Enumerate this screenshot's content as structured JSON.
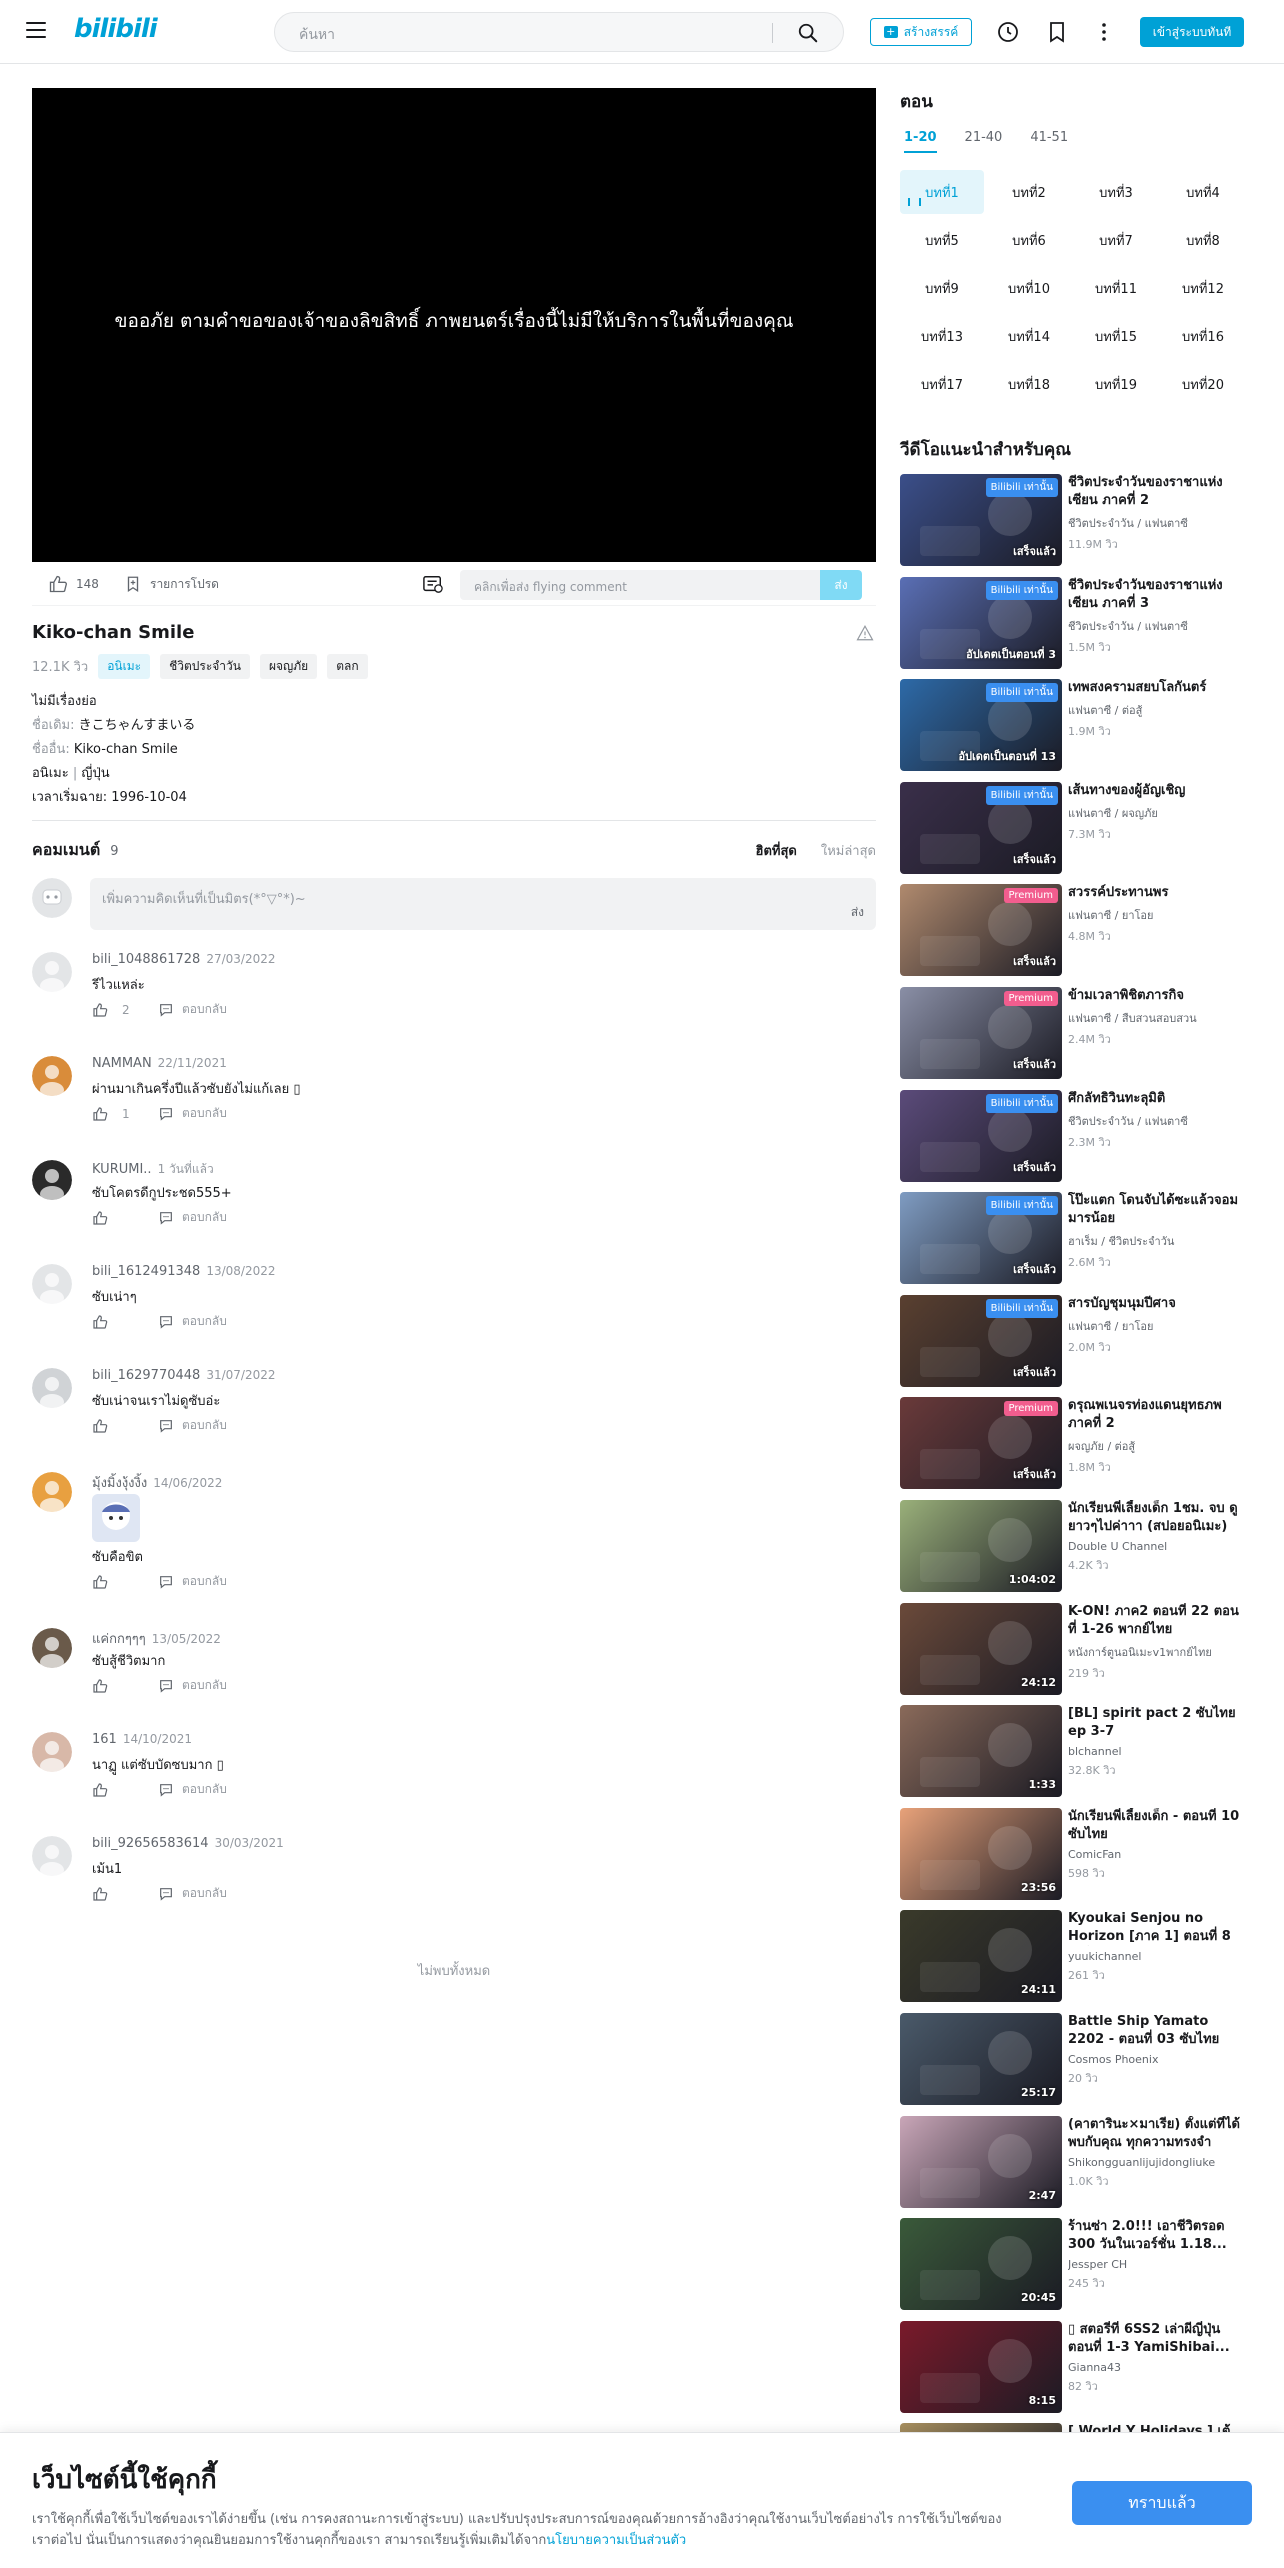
{
  "header": {
    "logo": "bilibili",
    "search_placeholder": "ค้นหา",
    "create_label": "สร้างสรรค์",
    "login_label": "เข้าสู่ระบบทันที"
  },
  "player": {
    "message": "ขออภัย ตามคำขอของเจ้าของลิขสิทธิ์ ภาพยนตร์เรื่องนี้ไม่มีให้บริการในพื้นที่ของคุณ",
    "likes": "148",
    "favorite_label": "รายการโปรด",
    "danmaku_placeholder": "คลิกเพื่อส่ง flying comment",
    "send_label": "ส่ง"
  },
  "video": {
    "title": "Kiko-chan Smile",
    "views": "12.1K วิว",
    "tags": [
      "อนิเมะ",
      "ชีวิตประจำวัน",
      "ผจญภัย",
      "ตลก"
    ],
    "synopsis": "ไม่มีเรื่องย่อ",
    "original_name_label": "ชื่อเดิม:",
    "original_name": "きこちゃんすまいる",
    "other_name_label": "ชื่ออื่น:",
    "other_name": "Kiko-chan Smile",
    "category": "อนิเมะ",
    "country": "ญี่ปุ่น",
    "airdate": "เวลาเริ่มฉาย: 1996-10-04"
  },
  "comments": {
    "title": "คอมเมนต์",
    "count": "9",
    "sort_hot": "ฮิตที่สุด",
    "sort_new": "ใหม่ล่าสุด",
    "input_placeholder": "เพิ่มความคิดเห็นที่เป็นมิตร(*°▽°*)~",
    "input_send": "ส่ง",
    "reply_label": "ตอบกลับ",
    "no_more": "ไม่พบทั้งหมด",
    "items": [
      {
        "user": "bili_1048861728",
        "date": "27/03/2022",
        "text": "รีไวแหล่ะ",
        "likes": "2"
      },
      {
        "user": "NAMMAN",
        "date": "22/11/2021",
        "text": "ผ่านมาเกินครึ่งปีแล้วซับยังไม่แก้เลย ▯",
        "likes": "1"
      },
      {
        "user": "KURUMI..",
        "date": "1 วันที่แล้ว",
        "text": "ซับโคตรดีกูประชด555+",
        "likes": ""
      },
      {
        "user": "bili_1612491348",
        "date": "13/08/2022",
        "text": "ซับเน่าๆ",
        "likes": ""
      },
      {
        "user": "bili_1629770448",
        "date": "31/07/2022",
        "text": "ซับเน่าจนเราไม่ดูซับอ่ะ",
        "likes": ""
      },
      {
        "user": "มุ้งมิ้งงุ้งงิ้ง",
        "date": "14/06/2022",
        "text": "ซับคือขิต",
        "likes": ""
      },
      {
        "user": "แค่กกๆๆๆ",
        "date": "13/05/2022",
        "text": "ซับสู้ชีวิตมาก",
        "likes": ""
      },
      {
        "user": "161",
        "date": "14/10/2021",
        "text": "นาฏู แต่ซับบัดซบมาก ▯",
        "likes": ""
      },
      {
        "user": "bili_92656583614",
        "date": "30/03/2021",
        "text": "เม้น1",
        "likes": ""
      }
    ]
  },
  "episodes": {
    "title": "ตอน",
    "tabs": [
      "1-20",
      "21-40",
      "41-51"
    ],
    "items": [
      "บทที่1",
      "บทที่2",
      "บทที่3",
      "บทที่4",
      "บทที่5",
      "บทที่6",
      "บทที่7",
      "บทที่8",
      "บทที่9",
      "บทที่10",
      "บทที่11",
      "บทที่12",
      "บทที่13",
      "บทที่14",
      "บทที่15",
      "บทที่16",
      "บทที่17",
      "บทที่18",
      "บทที่19",
      "บทที่20"
    ]
  },
  "recommend": {
    "title": "วีดีโอแนะนำสำหรับคุณ",
    "items": [
      {
        "name": "ชีวิตประจำวันของราชาแห่งเซียน ภาคที่ 2",
        "sub": "ชีวิตประจำวัน / แฟนตาซี",
        "views": "11.9M วิว",
        "badge": "Bilibili เท่านั้น",
        "corner": "เสร็จแล้ว",
        "color": "#3b4f8a"
      },
      {
        "name": "ชีวิตประจำวันของราชาแห่งเซียน ภาคที่ 3",
        "sub": "ชีวิตประจำวัน / แฟนตาซี",
        "views": "1.5M วิว",
        "badge": "Bilibili เท่านั้น",
        "corner": "อัปเดตเป็นตอนที่ 3",
        "color": "#5a6fb5"
      },
      {
        "name": "เทพสงครามสยบโลกันตร์",
        "sub": "แฟนตาซี / ต่อสู้",
        "views": "1.9M วิว",
        "badge": "Bilibili เท่านั้น",
        "corner": "อัปเดตเป็นตอนที่ 13",
        "color": "#2d6aa8"
      },
      {
        "name": "เส้นทางของผู้อัญเชิญ",
        "sub": "แฟนตาซี / ผจญภัย",
        "views": "7.3M วิว",
        "badge": "Bilibili เท่านั้น",
        "corner": "เสร็จแล้ว",
        "color": "#3a2f4a"
      },
      {
        "name": "สวรรค์ประทานพร",
        "sub": "แฟนตาซี / ยาโอย",
        "views": "4.8M วิว",
        "badge": "Premium",
        "corner": "เสร็จแล้ว",
        "color": "#b08a6e"
      },
      {
        "name": "ข้ามเวลาพิชิตภารกิจ",
        "sub": "แฟนตาซี / สืบสวนสอบสวน",
        "views": "2.4M วิว",
        "badge": "Premium",
        "corner": "เสร็จแล้ว",
        "color": "#8a8fa6"
      },
      {
        "name": "ศึกลัทธิวินทะลุมิติ",
        "sub": "ชีวิตประจำวัน / แฟนตาซี",
        "views": "2.3M วิว",
        "badge": "Bilibili เท่านั้น",
        "corner": "เสร็จแล้ว",
        "color": "#5b4b7a"
      },
      {
        "name": "โป๊ะแตก โดนจับได้ซะแล้วจอมมารน้อย",
        "sub": "ฮาเร็ม / ชีวิตประจำวัน",
        "views": "2.6M วิว",
        "badge": "Bilibili เท่านั้น",
        "corner": "เสร็จแล้ว",
        "color": "#7f9cc2"
      },
      {
        "name": "สารบัญชุมนุมปีศาจ",
        "sub": "แฟนตาซี / ยาโอย",
        "views": "2.0M วิว",
        "badge": "Bilibili เท่านั้น",
        "corner": "เสร็จแล้ว",
        "color": "#5a4030"
      },
      {
        "name": "ดรุณพเนจรท่องแดนยุทธภพ ภาคที่ 2",
        "sub": "ผจญภัย / ต่อสู้",
        "views": "1.8M วิว",
        "badge": "Premium",
        "corner": "เสร็จแล้ว",
        "color": "#6a3a3a"
      },
      {
        "name": "นักเรียนพี่เลี้ยงเด็ก 1ชม. จบ ดูยาวๆไปค่าาา (สปอยอนิเมะ)",
        "sub": "Double U Channel",
        "views": "4.2K วิว",
        "badge": "",
        "corner": "1:04:02",
        "color": "#9ab07a"
      },
      {
        "name": "K-ON! ภาค2 ตอนที่ 22 ตอนที่ 1-26 พากย์ไทย",
        "sub": "หนังการ์ตูนอนิเมะv1พากย์ไทย",
        "views": "219 วิว",
        "badge": "",
        "corner": "24:12",
        "color": "#6b4a3a"
      },
      {
        "name": "[BL] spirit pact 2 ซับไทย ep 3-7",
        "sub": "blchannel",
        "views": "32.8K วิว",
        "badge": "",
        "corner": "1:33",
        "color": "#8a6a5a"
      },
      {
        "name": "นักเรียนพี่เลี้ยงเด็ก - ตอนที่ 10 ซับไทย",
        "sub": "ComicFan",
        "views": "598 วิว",
        "badge": "",
        "corner": "23:56",
        "color": "#e8a27a"
      },
      {
        "name": "Kyoukai Senjou no Horizon [ภาค 1] ตอนที่ 8 ซับไทย",
        "sub": "yuukichannel",
        "views": "261 วิว",
        "badge": "",
        "corner": "24:11",
        "color": "#3a3a2a"
      },
      {
        "name": "Battle Ship Yamato 2202 - ตอนที่ 03 ซับไทย",
        "sub": "Cosmos Phoenix",
        "views": "20 วิว",
        "badge": "",
        "corner": "25:17",
        "color": "#4a5a6a"
      },
      {
        "name": "(คาตารินะ×มาเรีย) ตั้งแต่ที่ได้พบกับคุณ ทุกความทรงจำ",
        "sub": "Shikongguanlijujidongliuke",
        "views": "1.0K วิว",
        "badge": "",
        "corner": "2:47",
        "color": "#c9a6b8"
      },
      {
        "name": "ร้านซ่า 2.0!!! เอาชีวิตรอด 300 วันในเวอร์ชั่น 1.18...",
        "sub": "Jessper CH",
        "views": "245 วิว",
        "badge": "",
        "corner": "20:45",
        "color": "#3a5a3a"
      },
      {
        "name": "▯ สตอรี่ที่ 6SS2 เล่าผีญี่ปุ่น ตอนที่ 1-3 YamiShibai...",
        "sub": "Gianna43",
        "views": "82 วิว",
        "badge": "",
        "corner": "8:15",
        "color": "#7a1a2a"
      },
      {
        "name": "[ World Y Holidays ] เต้",
        "sub": "",
        "views": "",
        "badge": "",
        "corner": "",
        "color": "#a89060"
      }
    ]
  },
  "cookie": {
    "title": "เว็บไซต์นี้ใช้คุกกี้",
    "body": "เราใช้คุกกี้เพื่อใช้เว็บไซต์ของเราได้ง่ายขึ้น (เช่น การคงสถานะการเข้าสู่ระบบ) และปรับปรุงประสบการณ์ของคุณด้วยการอ้างอิงว่าคุณใช้งานเว็บไซต์อย่างไร การใช้เว็บไซต์ของเราต่อไป นั่นเป็นการแสดงว่าคุณยินยอมการใช้งานคุกกี้ของเรา สามารถเรียนรู้เพิ่มเติมได้จาก",
    "link": "นโยบายความเป็นส่วนตัว",
    "accept": "ทราบแล้ว"
  }
}
